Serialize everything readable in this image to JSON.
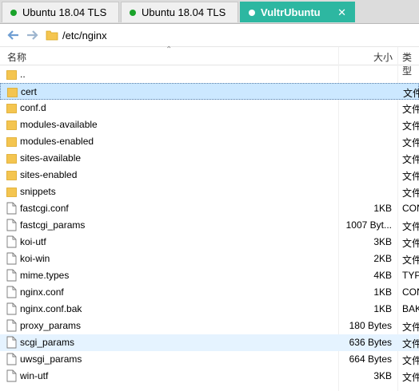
{
  "tabs": [
    {
      "label": "Ubuntu 18.04 TLS",
      "status_color": "#1aa32a",
      "active": false
    },
    {
      "label": "Ubuntu 18.04 TLS",
      "status_color": "#1aa32a",
      "active": false
    },
    {
      "label": "VultrUbuntu",
      "status_color": "#ffffff",
      "active": true,
      "close": "✕"
    }
  ],
  "address": {
    "back_icon": "back-arrow-icon",
    "forward_icon": "forward-arrow-icon",
    "path": "/etc/nginx"
  },
  "columns": {
    "name": "名称",
    "size": "大小",
    "type": "类型"
  },
  "rows": [
    {
      "name": "..",
      "size": "",
      "type": "",
      "icon": "folder-icon"
    },
    {
      "name": "cert",
      "size": "",
      "type": "文件夹",
      "icon": "folder-icon"
    },
    {
      "name": "conf.d",
      "size": "",
      "type": "文件夹",
      "icon": "folder-icon"
    },
    {
      "name": "modules-available",
      "size": "",
      "type": "文件夹",
      "icon": "folder-icon"
    },
    {
      "name": "modules-enabled",
      "size": "",
      "type": "文件夹",
      "icon": "folder-icon"
    },
    {
      "name": "sites-available",
      "size": "",
      "type": "文件夹",
      "icon": "folder-icon"
    },
    {
      "name": "sites-enabled",
      "size": "",
      "type": "文件夹",
      "icon": "folder-icon"
    },
    {
      "name": "snippets",
      "size": "",
      "type": "文件夹",
      "icon": "folder-icon"
    },
    {
      "name": "fastcgi.conf",
      "size": "1KB",
      "type": "CONF",
      "icon": "file-icon"
    },
    {
      "name": "fastcgi_params",
      "size": "1007 Byt...",
      "type": "文件",
      "icon": "file-icon"
    },
    {
      "name": "koi-utf",
      "size": "3KB",
      "type": "文件",
      "icon": "file-icon"
    },
    {
      "name": "koi-win",
      "size": "2KB",
      "type": "文件",
      "icon": "file-icon"
    },
    {
      "name": "mime.types",
      "size": "4KB",
      "type": "TYPES",
      "icon": "file-icon"
    },
    {
      "name": "nginx.conf",
      "size": "1KB",
      "type": "CONF",
      "icon": "file-icon"
    },
    {
      "name": "nginx.conf.bak",
      "size": "1KB",
      "type": "BAK",
      "icon": "file-icon"
    },
    {
      "name": "proxy_params",
      "size": "180 Bytes",
      "type": "文件",
      "icon": "file-icon"
    },
    {
      "name": "scgi_params",
      "size": "636 Bytes",
      "type": "文件",
      "icon": "file-icon"
    },
    {
      "name": "uwsgi_params",
      "size": "664 Bytes",
      "type": "文件",
      "icon": "file-icon"
    },
    {
      "name": "win-utf",
      "size": "3KB",
      "type": "文件",
      "icon": "file-icon"
    }
  ],
  "selected_row": "cert",
  "hover_row": "scgi_params",
  "colors": {
    "active_tab": "#2db7a1",
    "selection": "#cce8ff",
    "hover": "#e5f3ff",
    "folder": "#f4c550"
  }
}
